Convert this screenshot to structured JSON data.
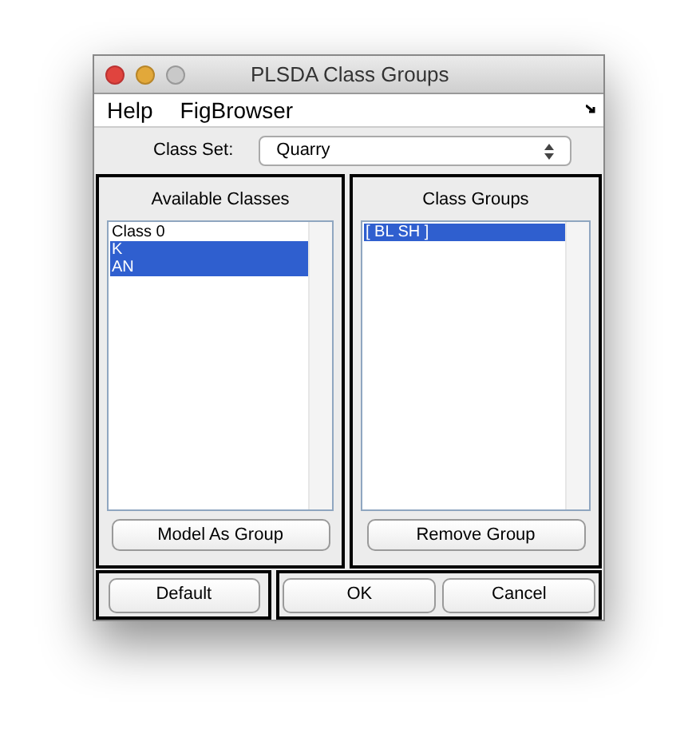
{
  "window": {
    "title": "PLSDA Class Groups"
  },
  "menu": [
    "Help",
    "FigBrowser"
  ],
  "class_set": {
    "label": "Class Set:",
    "value": "Quarry"
  },
  "available": {
    "title": "Available Classes",
    "items": [
      {
        "label": "Class 0",
        "selected": false
      },
      {
        "label": "K",
        "selected": true
      },
      {
        "label": "AN",
        "selected": true
      }
    ],
    "button": "Model As Group"
  },
  "groups": {
    "title": "Class Groups",
    "items": [
      {
        "label": "[ BL SH ]",
        "selected": true
      }
    ],
    "button": "Remove Group"
  },
  "buttons": [
    "Default",
    "OK",
    "Cancel"
  ]
}
